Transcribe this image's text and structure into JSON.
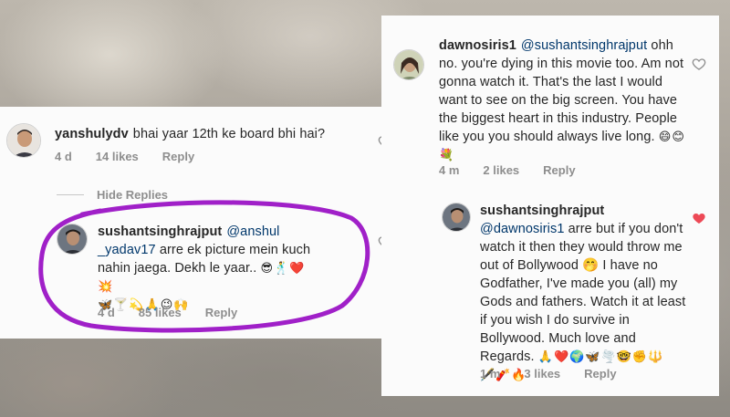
{
  "left": {
    "comment1": {
      "username": "yanshulydv",
      "text": "bhai yaar 12th ke board bhi hai?",
      "time": "4 d",
      "likes": "14 likes",
      "reply": "Reply"
    },
    "hide_replies": "Hide Replies",
    "comment2": {
      "username": "sushantsinghrajput",
      "mention": "@anshul _yadav17",
      "text": "arre ek picture mein kuch nahin jaega. Dekh le yaar..",
      "emojis_line1": "😎🕺❤️💥",
      "emojis_line2": "🦋🍸💫🙏😉🙌",
      "time": "4 d",
      "likes": "85 likes",
      "reply": "Reply"
    }
  },
  "right": {
    "comment1": {
      "username": "dawnosiris1",
      "mention": "@sushantsinghrajput",
      "text": "ohh no. you're dying in this movie too. Am not gonna watch it. That's the last I would want to see on the big screen. You have the biggest heart in this industry. People like you you should always live long.",
      "emojis": "😄😊💐",
      "time": "4 m",
      "likes": "2 likes",
      "reply": "Reply"
    },
    "comment2": {
      "username": "sushantsinghrajput",
      "mention": "@dawnosiris1",
      "text": "arre but if you don't watch it then they would throw me out of Bollywood 🤭 I have no Godfather, I've made you (all) my Gods and fathers. Watch it at least if you wish I do survive in Bollywood. Much love and Regards.",
      "emojis_line1": "🙏❤️🌍🦋🌪️🤓✊🔱",
      "emojis_line2": "🖋️🧨🔥",
      "time": "1 m",
      "likes": "3 likes",
      "reply": "Reply"
    }
  },
  "colors": {
    "liked_heart": "#ed4956",
    "circle": "#a020c8"
  }
}
